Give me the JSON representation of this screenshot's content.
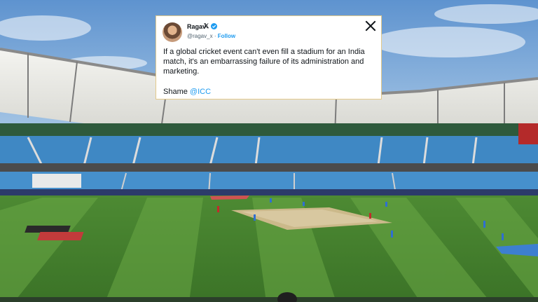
{
  "tweet": {
    "display_name": "Ragav",
    "x_badge": "𝕏",
    "handle": "@ragav_x",
    "separator": "·",
    "follow_label": "Follow",
    "close_label": "X",
    "body_text": "If a global cricket event can't even fill a stadium for an India match, it's an embarrassing failure of its administration and marketing.",
    "shame_word": "Shame ",
    "mention": "@ICC"
  },
  "colors": {
    "sky": "#6f9ed1",
    "seats": "#3f88c4",
    "grass_light": "#5f9a3c",
    "grass_dark": "#3f7a2a",
    "link": "#1d9bf0"
  }
}
